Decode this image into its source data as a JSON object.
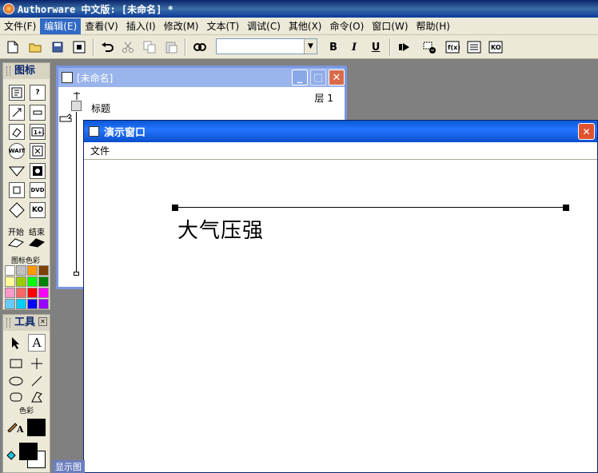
{
  "app": {
    "title": "Authorware 中文版: [未命名] *"
  },
  "menubar": [
    {
      "label": "文件(F)"
    },
    {
      "label": "编辑(E)"
    },
    {
      "label": "查看(V)"
    },
    {
      "label": "插入(I)"
    },
    {
      "label": "修改(M)"
    },
    {
      "label": "文本(T)"
    },
    {
      "label": "调试(C)"
    },
    {
      "label": "其他(X)"
    },
    {
      "label": "命令(O)"
    },
    {
      "label": "窗口(W)"
    },
    {
      "label": "帮助(H)"
    }
  ],
  "toolbar": {
    "style_value": "",
    "bold_label": "B",
    "italic_label": "I",
    "underline_label": "U"
  },
  "icon_palette": {
    "title": "图标",
    "start_label": "开始",
    "end_label": "结束",
    "icon_colors_label": "图标色彩",
    "colors": [
      "#ffffff",
      "#c0c0c0",
      "#ff9900",
      "#804000",
      "#ffff99",
      "#99cc00",
      "#00ff00",
      "#008000",
      "#ff99cc",
      "#ff6666",
      "#ff0000",
      "#ff00ff",
      "#66ccff",
      "#00ccff",
      "#0000ff",
      "#9900ff"
    ]
  },
  "tools_palette": {
    "title": "工具",
    "colors_label": "色彩",
    "text_tool_label": "A",
    "pencil_label": "A",
    "line_color": "#000000",
    "fill_fg": "#000000",
    "fill_bg": "#ffffff"
  },
  "flow_window": {
    "title": "[未命名]",
    "level_label": "层 1",
    "icon_label": "标题"
  },
  "presentation_window": {
    "title": "演示窗口",
    "menu_file": "文件",
    "text": "大气压强"
  },
  "display_tab": {
    "label": "显示图"
  }
}
